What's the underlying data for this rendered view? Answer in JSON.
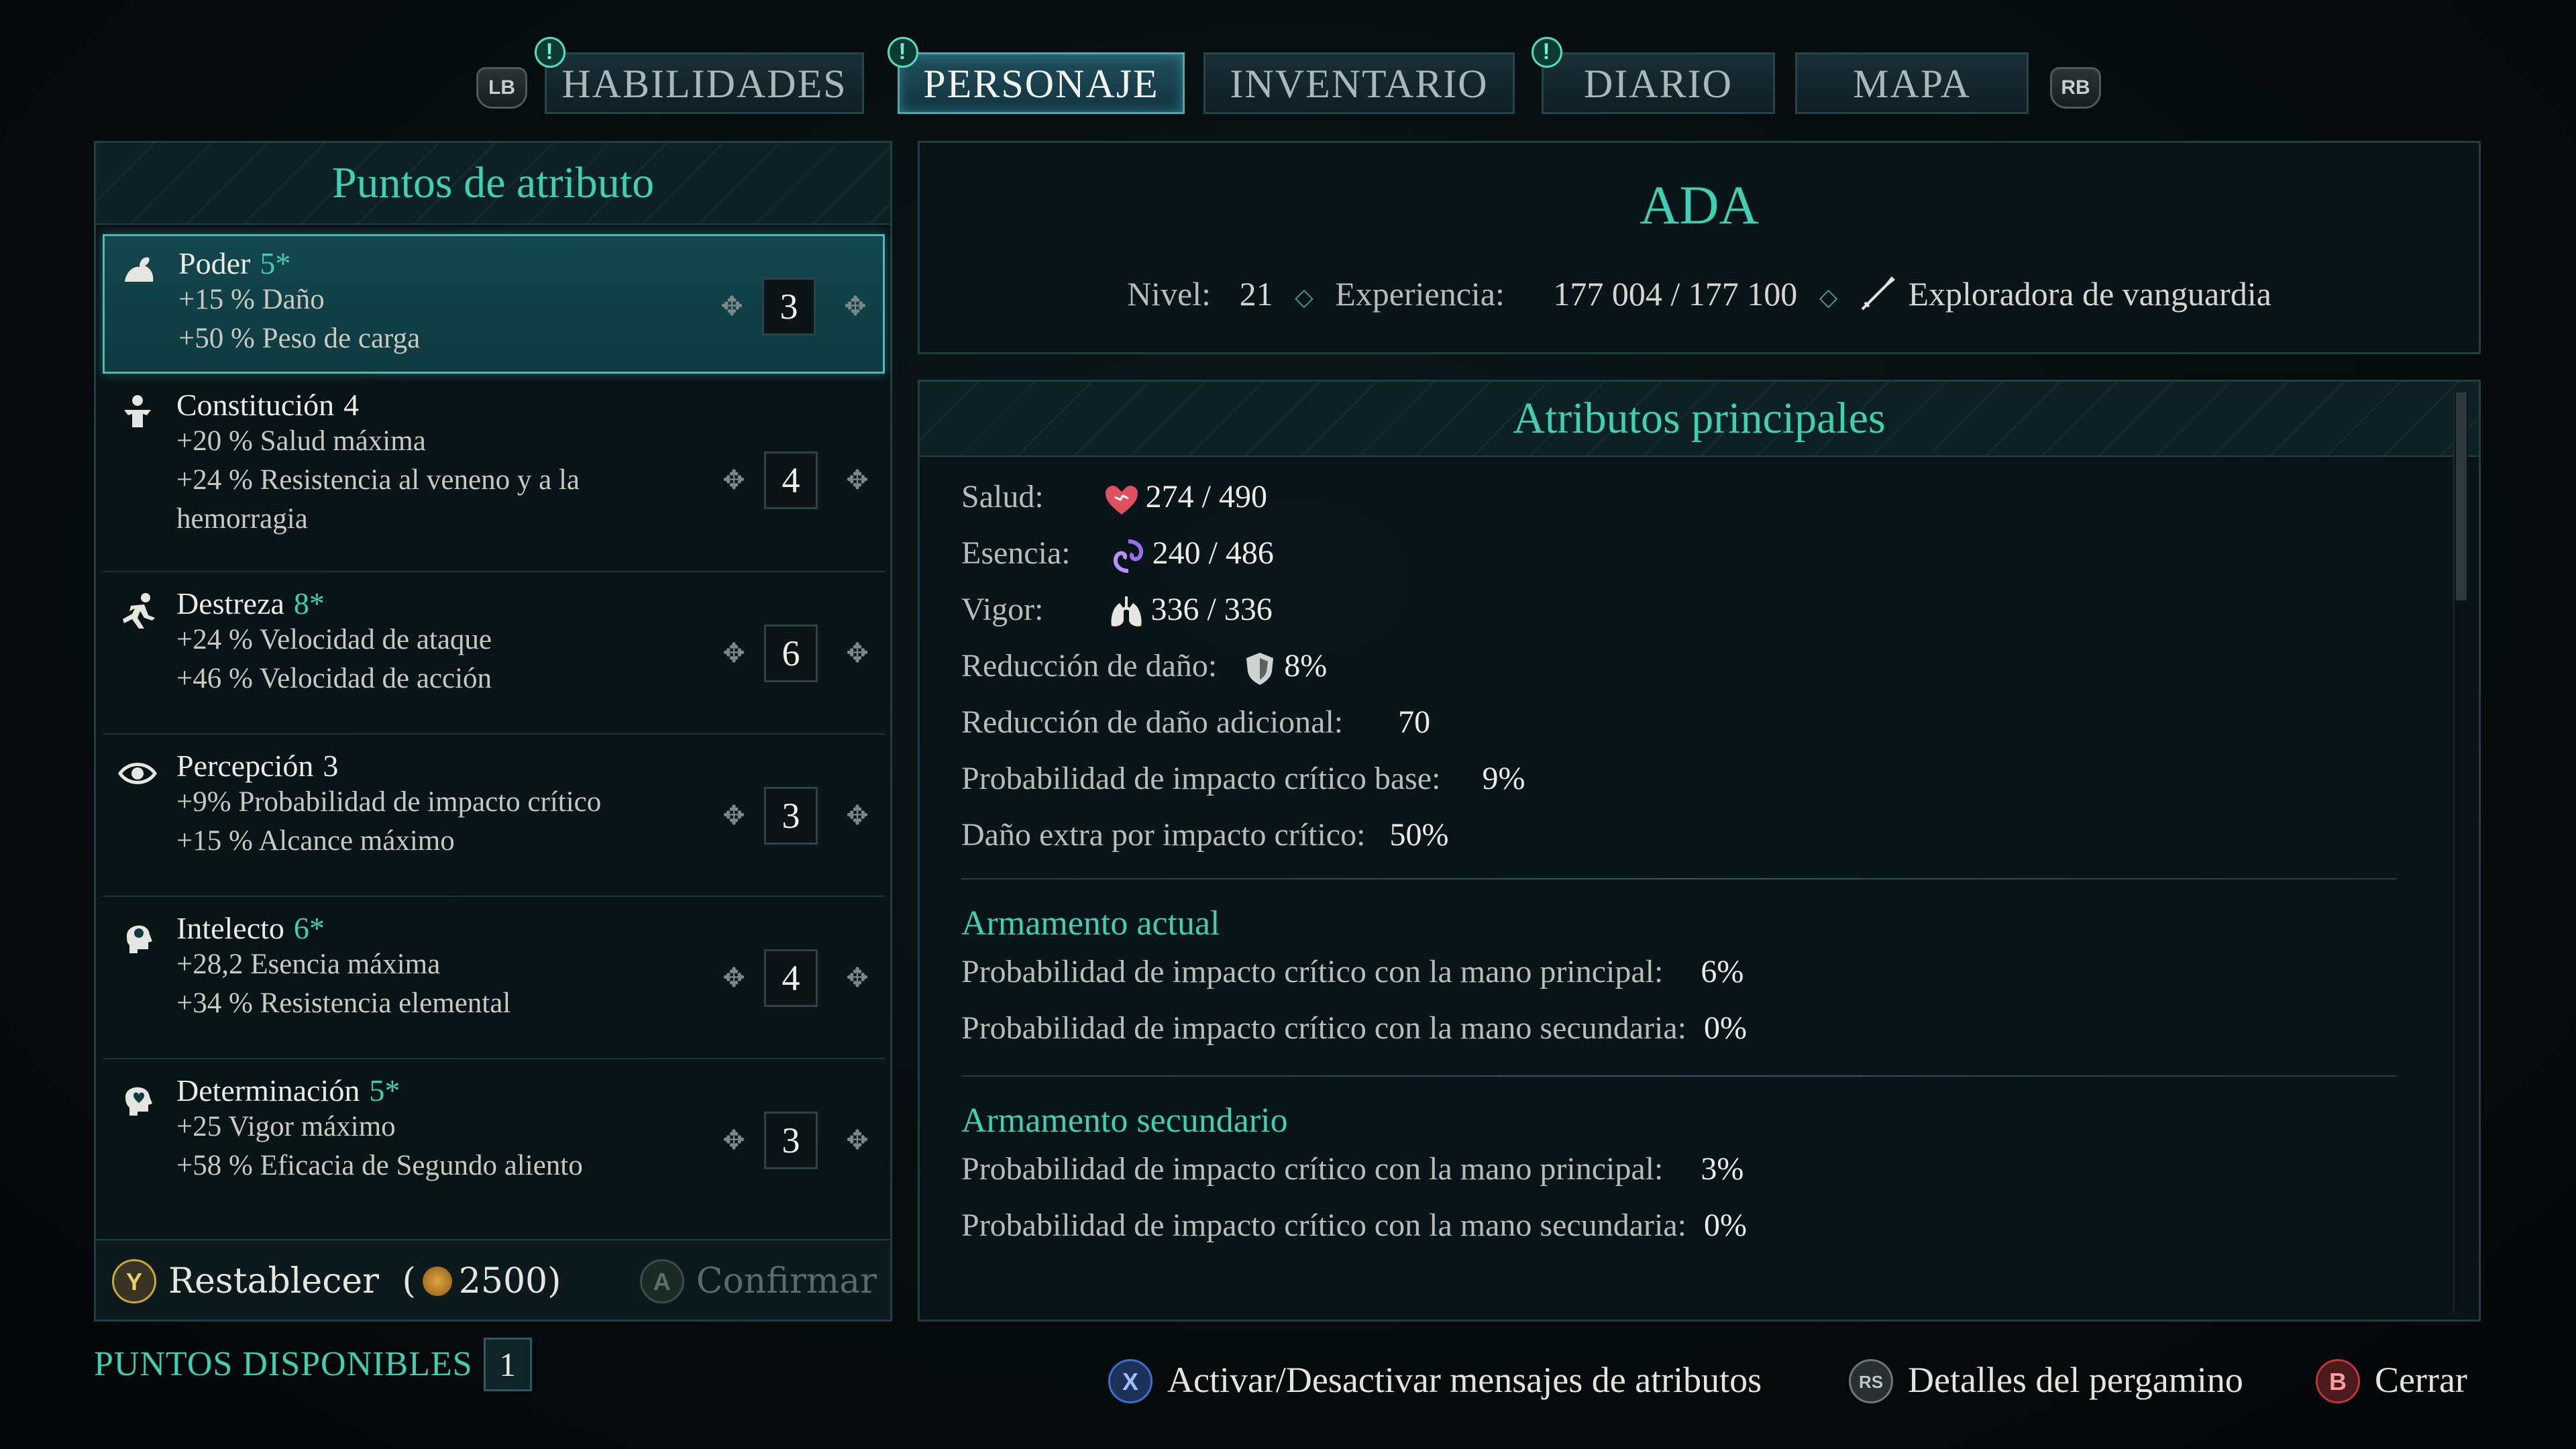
{
  "tabs": {
    "left_shoulder": "LB",
    "right_shoulder": "RB",
    "items": [
      {
        "label": "HABILIDADES",
        "badge": "!"
      },
      {
        "label": "PERSONAJE",
        "badge": "!"
      },
      {
        "label": "INVENTARIO",
        "badge": ""
      },
      {
        "label": "DIARIO",
        "badge": "!"
      },
      {
        "label": "MAPA",
        "badge": ""
      }
    ]
  },
  "attributes": {
    "title": "Puntos de atributo",
    "items": [
      {
        "name": "Poder",
        "bonus": "5*",
        "lines": [
          "+15 % Daño",
          "+50 % Peso de carga"
        ],
        "value": "3",
        "icon": "arm-flex-icon"
      },
      {
        "name": "Constitución",
        "bonus": "4",
        "lines": [
          "+20 % Salud máxima",
          "+24 % Resistencia al veneno y a la",
          "hemorragia"
        ],
        "value": "4",
        "icon": "body-icon"
      },
      {
        "name": "Destreza",
        "bonus": "8*",
        "lines": [
          "+24 % Velocidad de ataque",
          "+46 % Velocidad de acción"
        ],
        "value": "6",
        "icon": "runner-icon"
      },
      {
        "name": "Percepción",
        "bonus": "3",
        "lines": [
          "+9% Probabilidad de impacto crítico",
          "+15 % Alcance máximo"
        ],
        "value": "3",
        "icon": "eye-icon"
      },
      {
        "name": "Intelecto",
        "bonus": "6*",
        "lines": [
          "+28,2 Esencia máxima",
          "+34 % Resistencia elemental"
        ],
        "value": "4",
        "icon": "head-icon"
      },
      {
        "name": "Determinación",
        "bonus": "5*",
        "lines": [
          "+25 Vigor máximo",
          "+58 % Eficacia de Segundo aliento"
        ],
        "value": "3",
        "icon": "heart-head-icon"
      }
    ],
    "reset_button": "Y",
    "reset_label": "Restablecer",
    "reset_cost_open": "(",
    "reset_cost": "2500",
    "reset_cost_close": ")",
    "confirm_button": "A",
    "confirm_label": "Confirmar",
    "available_label": "PUNTOS DISPONIBLES",
    "available_value": "1"
  },
  "character": {
    "name": "ADA",
    "level_label": "Nivel:",
    "level": "21",
    "xp_label": "Experiencia:",
    "xp": "177 004 / 177 100",
    "class": "Exploradora de vanguardia"
  },
  "main": {
    "title": "Atributos principales",
    "stats": [
      {
        "label": "Salud:",
        "value": "274 / 490",
        "icon": "heart-icon"
      },
      {
        "label": "Esencia:",
        "value": "240 / 486",
        "icon": "essence-swirl-icon"
      },
      {
        "label": "Vigor:",
        "value": "336 / 336",
        "icon": "lungs-icon"
      },
      {
        "label": "Reducción de daño:",
        "value": "8%",
        "icon": "shield-icon"
      },
      {
        "label": "Reducción de daño adicional:",
        "value": "70",
        "icon": ""
      },
      {
        "label": "Probabilidad de impacto crítico base:",
        "value": "9%",
        "icon": ""
      },
      {
        "label": "Daño extra por impacto crítico:",
        "value": "50%",
        "icon": ""
      }
    ],
    "sections": [
      {
        "title": "Armamento actual",
        "rows": [
          {
            "label": "Probabilidad de impacto crítico con la mano principal:",
            "value": "6%"
          },
          {
            "label": "Probabilidad de impacto crítico con la mano secundaria:",
            "value": "0%"
          }
        ]
      },
      {
        "title": "Armamento secundario",
        "rows": [
          {
            "label": "Probabilidad de impacto crítico con la mano principal:",
            "value": "3%"
          },
          {
            "label": "Probabilidad de impacto crítico con la mano secundaria:",
            "value": "0%"
          }
        ]
      }
    ]
  },
  "hints": [
    {
      "button": "X",
      "label": "Activar/Desactivar mensajes de atributos"
    },
    {
      "button": "RS",
      "label": "Detalles del pergamino"
    },
    {
      "button": "B",
      "label": "Cerrar"
    }
  ],
  "colors": {
    "accent": "#3fd0b4",
    "panel": "#0a1619",
    "border": "#1f3f44",
    "y_button": "#c9a83a",
    "x_button": "#3b6fd0",
    "b_button": "#c0353a"
  }
}
